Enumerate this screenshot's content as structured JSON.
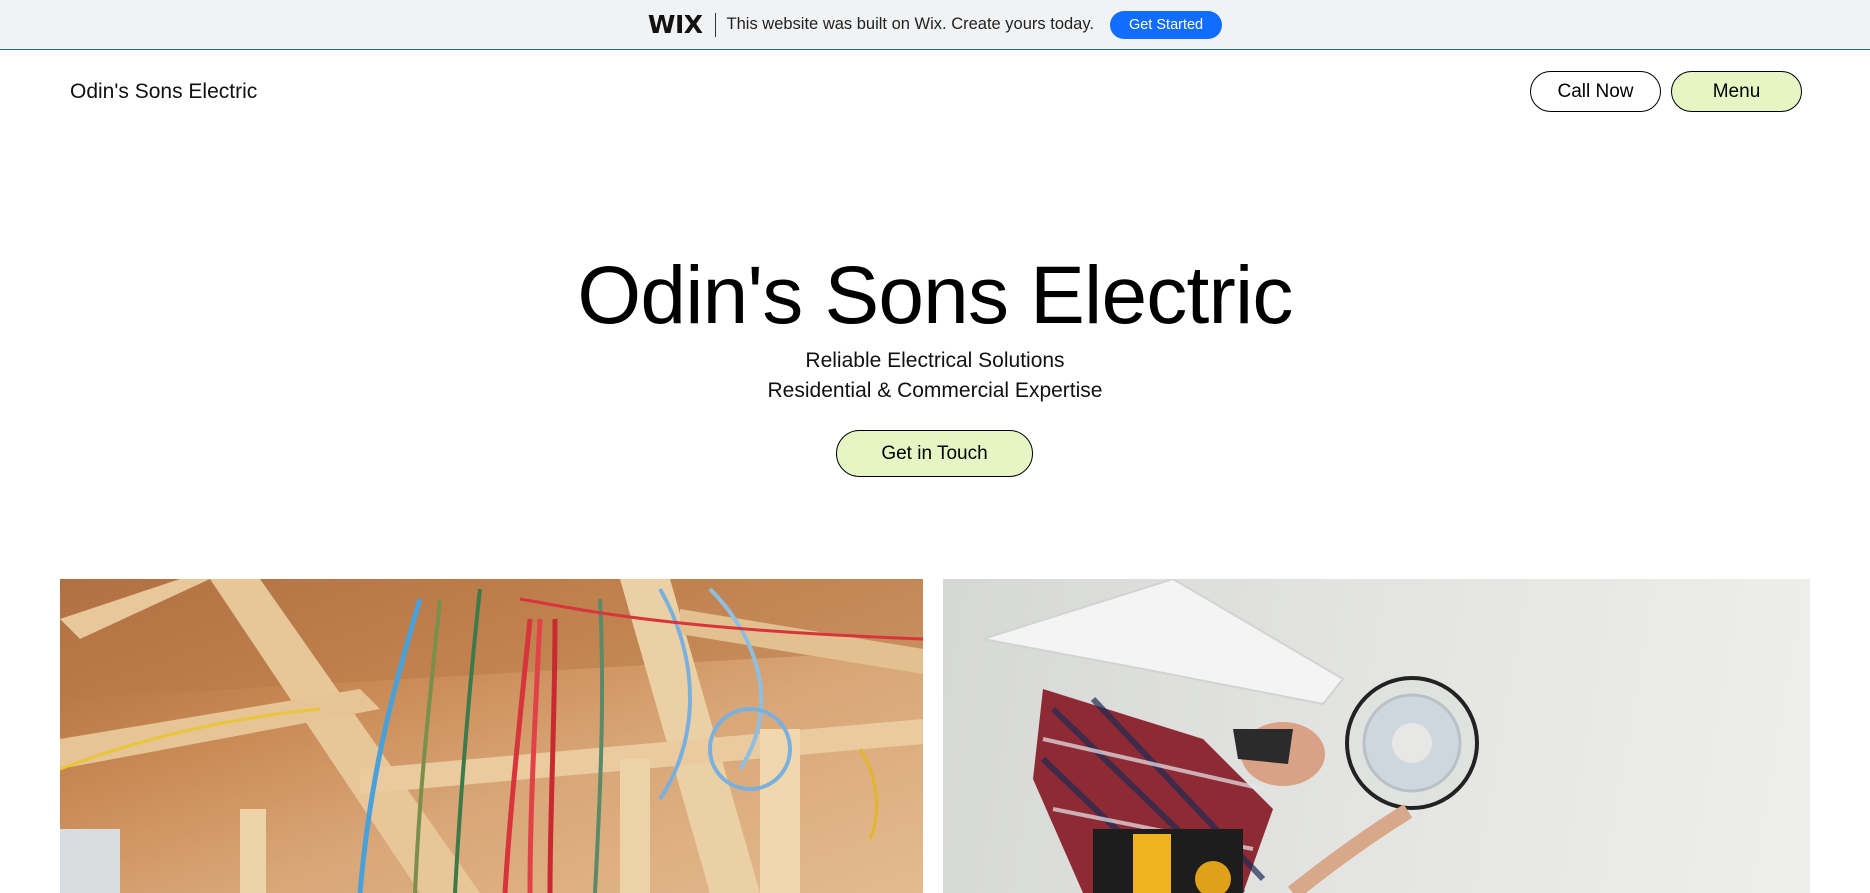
{
  "wix_banner": {
    "logo": "WIX",
    "message": "This website was built on Wix. Create yours today.",
    "button_label": "Get Started"
  },
  "header": {
    "site_name": "Odin's Sons Electric",
    "call_button": "Call Now",
    "menu_button": "Menu"
  },
  "hero": {
    "title": "Odin's Sons Electric",
    "subtitle_line1": "Reliable Electrical Solutions",
    "subtitle_line2": "Residential & Commercial Expertise",
    "cta_label": "Get in Touch"
  },
  "colors": {
    "accent_green": "#e6f5c4",
    "wix_blue": "#116dff",
    "banner_bg": "#f1f2f4"
  },
  "images": [
    {
      "name": "wiring-ceiling-photo"
    },
    {
      "name": "electrician-installing-light-photo"
    }
  ]
}
